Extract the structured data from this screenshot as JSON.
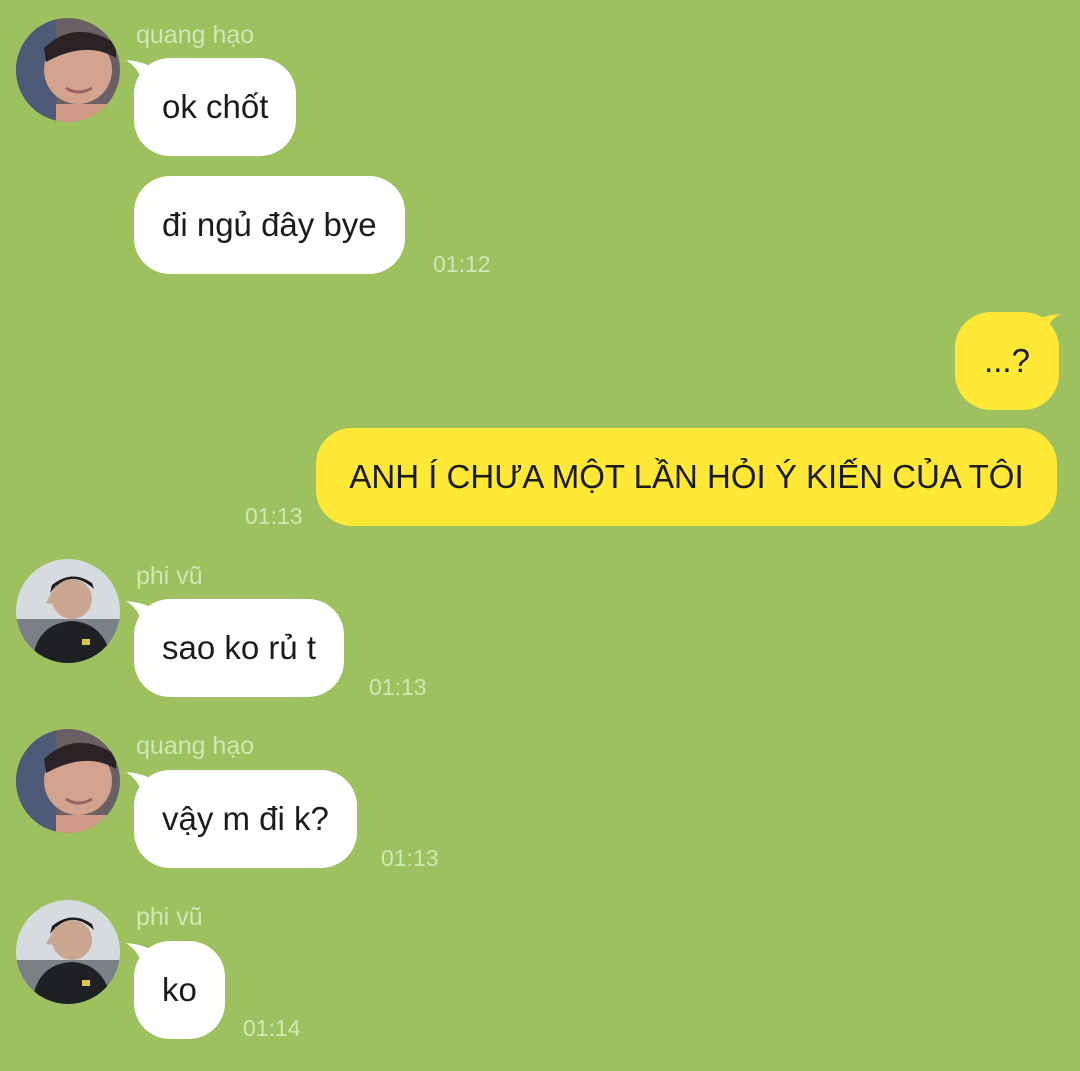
{
  "colors": {
    "background": "#9dc15f",
    "incoming_bubble": "#ffffff",
    "outgoing_bubble": "#ffe936",
    "meta_text": "#d3e6b3"
  },
  "messages": [
    {
      "sender": "quang hạo",
      "text": "ok chốt"
    },
    {
      "text": "đi ngủ đây bye",
      "time": "01:12"
    },
    {
      "text": "...?"
    },
    {
      "text": "ANH Í CHƯA MỘT LẦN HỎI Ý KIẾN CỦA TÔI",
      "time": "01:13"
    },
    {
      "sender": "phi vũ",
      "text": "sao ko rủ t",
      "time": "01:13"
    },
    {
      "sender": "quang hạo",
      "text": "vậy m đi k?",
      "time": "01:13"
    },
    {
      "sender": "phi vũ",
      "text": "ko",
      "time": "01:14"
    }
  ]
}
